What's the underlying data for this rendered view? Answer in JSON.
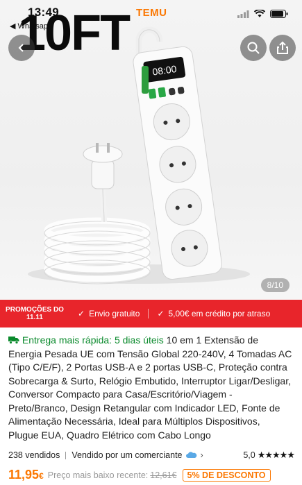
{
  "status_bar": {
    "time": "13:49",
    "back_app": "◀ Whatsapp",
    "brand": "TEMU"
  },
  "overlay_title": "10FT",
  "product_image": {
    "clock_display": "08:00",
    "pager": "8/10"
  },
  "promo_bar": {
    "label_line1": "PROMOÇÕES DO",
    "label_line2": "11.11",
    "shipping": "Envio gratuito",
    "credit": "5,00€ em crédito por atraso"
  },
  "description": {
    "delivery": "Entrega mais rápida: 5 dias úteis",
    "title": "10 em 1 Extensão de Energia Pesada UE com Tensão Global 220-240V, 4 Tomadas AC (Tipo C/E/F), 2 Portas USB-A e 2 portas USB-C, Proteção contra Sobrecarga & Surto, Relógio Embutido, Interruptor Ligar/Desligar, Conversor Compacto para Casa/Escritório/Viagem - Preto/Branco, Design Retangular com Indicador LED, Fonte de Alimentação Necessária, Ideal para Múltiplos Dispositivos, Plugue EUA, Quadro Elétrico com Cabo Longo"
  },
  "meta": {
    "sold": "238 vendidos",
    "seller": "Vendido por um comerciante",
    "rating": "5,0",
    "stars": "★★★★★"
  },
  "price": {
    "current_main": "11,95",
    "current_currency": "€",
    "recent_label": "Preço mais baixo recente:",
    "old_price": "12,61€",
    "discount": "5% DE DESCONTO"
  },
  "colors": {
    "brand_orange": "#fb7701",
    "promo_red": "#e8252b",
    "delivery_green": "#0a8a2c"
  }
}
